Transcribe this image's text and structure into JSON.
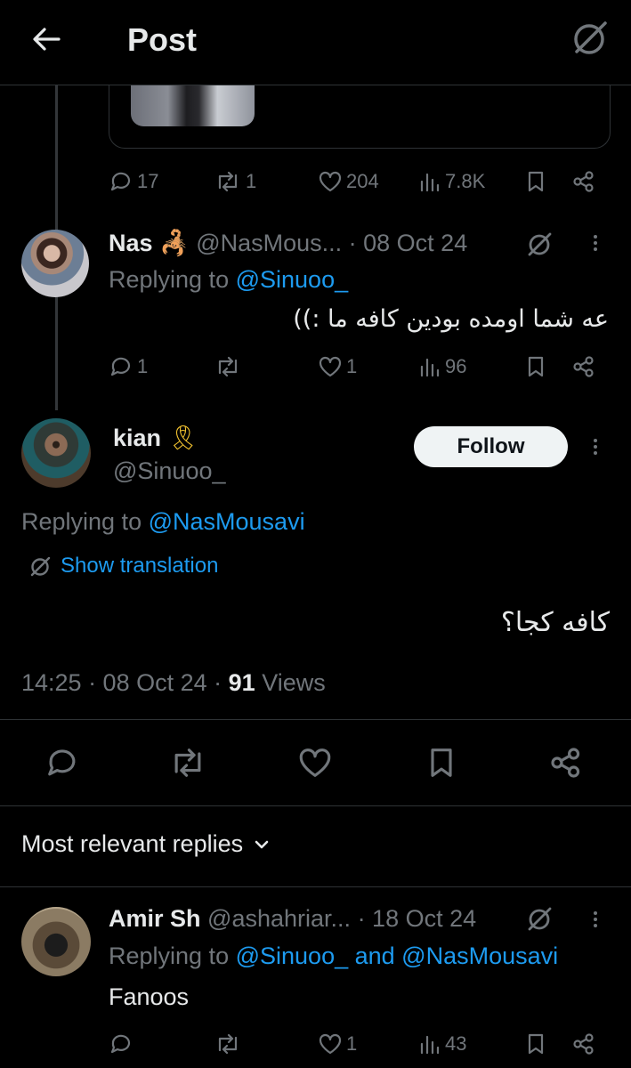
{
  "header": {
    "title": "Post"
  },
  "top_post_stats": {
    "replies": "17",
    "reposts": "1",
    "likes": "204",
    "views": "7.8K"
  },
  "reply1": {
    "name": "Nas",
    "handle": "@NasMous...",
    "date": "· 08 Oct 24",
    "replying_prefix": "Replying to",
    "replying_to": "@Sinuoo_",
    "text": "عه شما اومده بودین کافه ما :))",
    "stats": {
      "replies": "1",
      "reposts": "",
      "likes": "1",
      "views": "96"
    }
  },
  "main_post": {
    "name": "kian",
    "handle": "@Sinuoo_",
    "follow_label": "Follow",
    "replying_prefix": "Replying to",
    "replying_to": "@NasMousavi",
    "translate_label": "Show translation",
    "text": "کافه کجا؟",
    "time": "14:25 · 08 Oct 24 ·",
    "views_count": "91",
    "views_label": "Views"
  },
  "sort": {
    "label": "Most relevant replies"
  },
  "reply2": {
    "name": "Amir Sh",
    "handle": "@ashahriar...",
    "date": "· 18 Oct 24",
    "replying_prefix": "Replying to",
    "replying_to": "@Sinuoo_ and @NasMousavi",
    "text": "Fanoos",
    "stats": {
      "replies": "",
      "reposts": "",
      "likes": "1",
      "views": "43"
    }
  },
  "colors": {
    "background": "#000000",
    "accent": "#1d9bf0",
    "muted": "#71767b",
    "text": "#e7e9ea",
    "border": "#2f3336"
  }
}
